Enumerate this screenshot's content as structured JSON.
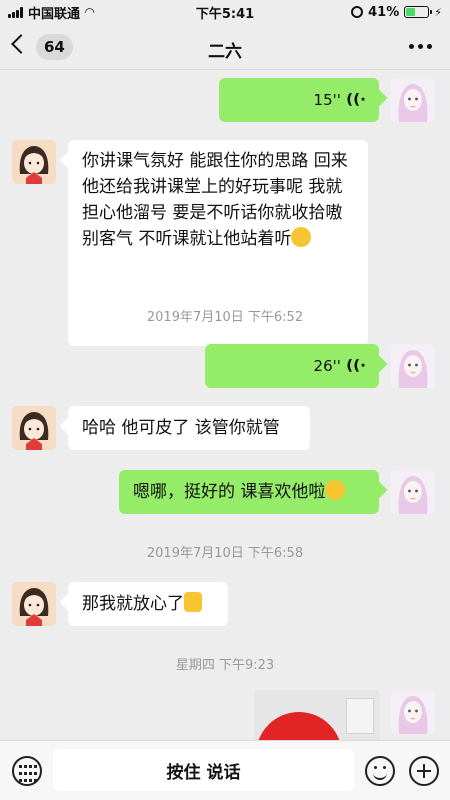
{
  "status_bar": {
    "carrier": "中国联通",
    "time": "下午5:41",
    "battery": "41%",
    "battery_level": 0.41
  },
  "nav": {
    "back_count": "64",
    "title": "二六",
    "more_icon": "more-horizontal-icon"
  },
  "messages": [
    {
      "type": "voice",
      "direction": "out",
      "duration": "15''"
    },
    {
      "type": "text",
      "direction": "in",
      "text": "你讲课气氛好 能跟住你的思路 回来他还给我讲课堂上的好玩事呢 我就担心他溜号 要是不听话你就收拾嗷 别客气 不听课就让他站着听"
    },
    {
      "type": "timestamp",
      "text": "2019年7月10日 下午6:52"
    },
    {
      "type": "voice",
      "direction": "out",
      "duration": "26''"
    },
    {
      "type": "text",
      "direction": "in",
      "text": "哈哈 他可皮了 该管你就管"
    },
    {
      "type": "text",
      "direction": "out",
      "text": "嗯哪，挺好的 课喜欢他啦"
    },
    {
      "type": "timestamp",
      "text": "2019年7月10日 下午6:58"
    },
    {
      "type": "text",
      "direction": "in",
      "text": "那我就放心了"
    },
    {
      "type": "timestamp",
      "text": "星期四 下午9:23"
    },
    {
      "type": "image",
      "direction": "out"
    }
  ],
  "input_bar": {
    "hold_to_talk": "按住 说话",
    "keyboard_icon": "keyboard-icon",
    "emoji_icon": "emoji-icon",
    "plus_icon": "plus-icon"
  },
  "colors": {
    "background": "#ededed",
    "outgoing_bubble": "#95ec69",
    "incoming_bubble": "#ffffff"
  }
}
